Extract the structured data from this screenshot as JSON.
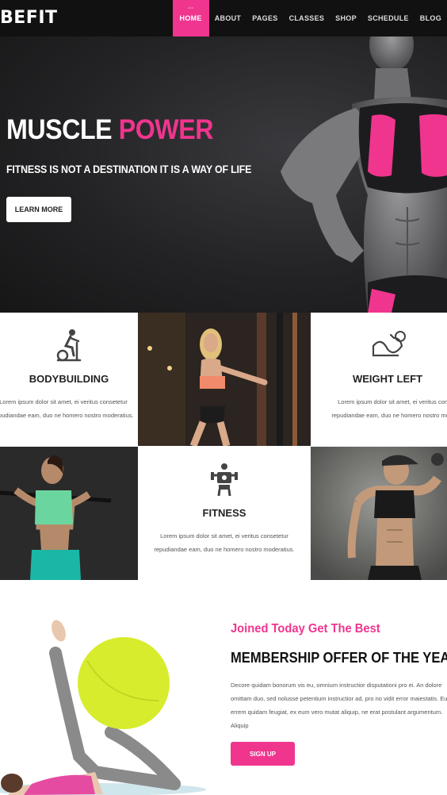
{
  "nav": {
    "logo": "BEFIT",
    "items": [
      {
        "label": "HOME",
        "active": true
      },
      {
        "label": "ABOUT"
      },
      {
        "label": "PAGES"
      },
      {
        "label": "CLASSES"
      },
      {
        "label": "SHOP"
      },
      {
        "label": "SCHEDULE"
      },
      {
        "label": "BLOG"
      }
    ]
  },
  "hero": {
    "title_white": "MUSCLE",
    "title_pink": "POWER",
    "subtitle": "FITNESS IS NOT A DESTINATION IT IS A WAY OF LIFE",
    "button": "LEARN MORE"
  },
  "features": {
    "bodybuilding": {
      "icon": "exercise-bike-icon",
      "title": "BODYBUILDING",
      "text": "Lorem ipsum dolor sit amet, ei veritus consetetur repudiandae eam, duo ne homero nostro moderatius."
    },
    "weight": {
      "icon": "flexed-arm-icon",
      "title": "WEIGHT LEFT",
      "text": "Lorem ipsum dolor sit amet, ei veritus consetetur repudiandae eam, duo ne homero nostro moderatius."
    },
    "fitness": {
      "icon": "robot-icon",
      "title": "FITNESS",
      "text": "Lorem ipsum dolor sit amet, ei veritus consetetur repudiandae eam, duo ne homero nostro moderatius."
    }
  },
  "membership": {
    "tagline": "Joined Today Get The Best",
    "title": "MEMBERSHIP OFFER OF THE YEAR",
    "text": "Decore quidam bonorum vis eu, omnium instructior disputationi pro ei. An dolore omittam duo, sed nolusse petentium instructior ad, pro no vidit error maiestatis. Eum errem quidam feugiat, ex eum vero mutat aliquip, ne erat postulant argumentum. Aliquip",
    "button": "SIGN UP"
  },
  "colors": {
    "accent": "#f0358e",
    "nav_bg": "#111111",
    "lime": "#d7ec2d"
  }
}
